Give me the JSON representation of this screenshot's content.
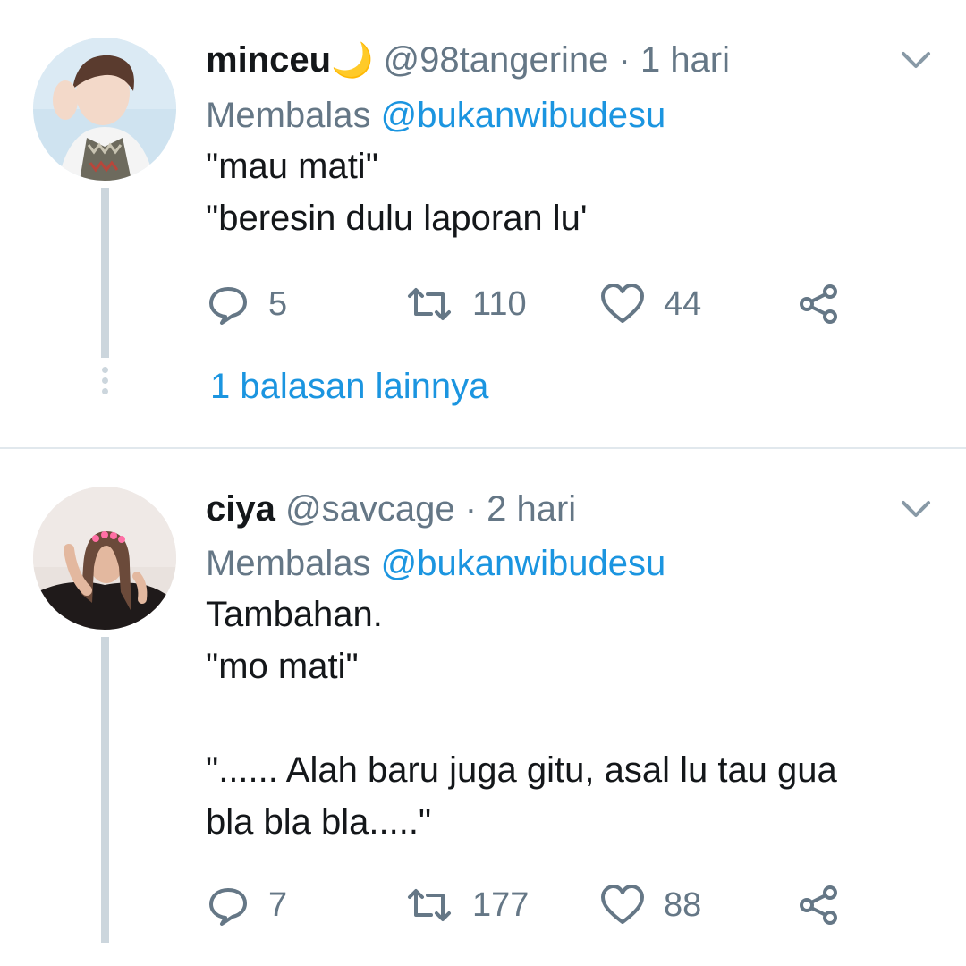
{
  "tweets": [
    {
      "display_name": "minceu",
      "emoji": "🌙",
      "handle": "@98tangerine",
      "separator": " · ",
      "time": "1 hari",
      "reply_prefix": "Membalas ",
      "reply_mention": "@bukanwibudesu",
      "text": "\"mau mati\"\n\"beresin dulu laporan lu'",
      "replies": "5",
      "retweets": "110",
      "likes": "44",
      "more_replies": "1 balasan lainnya"
    },
    {
      "display_name": "ciya",
      "handle": "@savcage",
      "separator": " · ",
      "time": "2 hari",
      "reply_prefix": "Membalas ",
      "reply_mention": "@bukanwibudesu",
      "text": "Tambahan.\n\"mo mati\"\n\n\"...... Alah baru juga gitu, asal lu tau gua\nbla bla bla.....\"",
      "replies": "7",
      "retweets": "177",
      "likes": "88"
    }
  ],
  "icons": {
    "reply": "reply-icon",
    "retweet": "retweet-icon",
    "like": "heart-icon",
    "share": "share-icon",
    "caret": "chevron-down-icon"
  },
  "colors": {
    "link": "#1b95e0",
    "muted": "#657786",
    "text": "#14171a",
    "thread_line": "#ccd6dd"
  }
}
